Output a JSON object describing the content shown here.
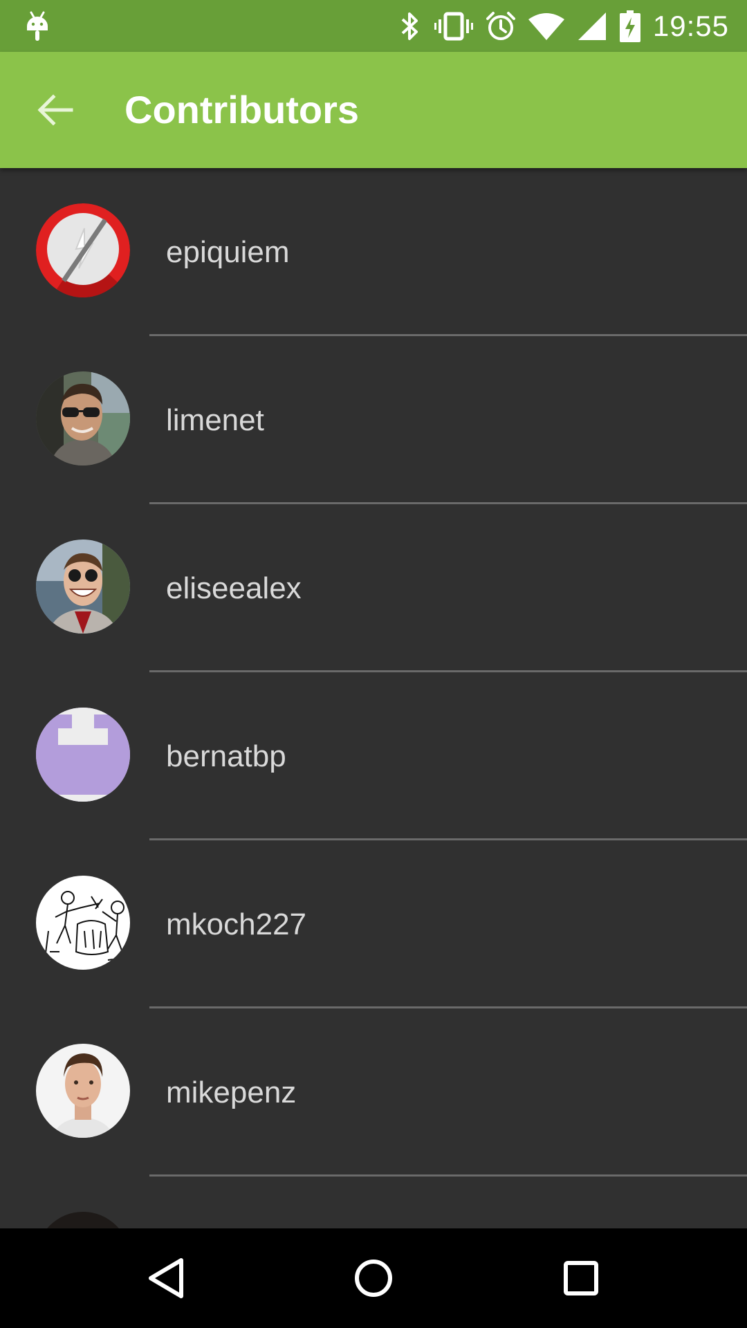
{
  "status_bar": {
    "time": "19:55",
    "icons": [
      "android-icon",
      "bluetooth-icon",
      "vibrate-icon",
      "alarm-icon",
      "wifi-icon",
      "cell-signal-icon",
      "battery-charging-icon"
    ]
  },
  "app_bar": {
    "title": "Contributors",
    "back_icon": "arrow-back-icon"
  },
  "colors": {
    "status_bar": "#689f38",
    "app_bar": "#8bc34a",
    "background": "#303030",
    "text": "#d9d9d9",
    "divider": "#6a6a6a",
    "nav_bar": "#000000"
  },
  "contributors": [
    {
      "name": "epiquiem",
      "avatar": "no-lightning-logo-avatar"
    },
    {
      "name": "limenet",
      "avatar": "photo-avatar-sunglasses"
    },
    {
      "name": "eliseealex",
      "avatar": "photo-avatar-smiling"
    },
    {
      "name": "bernatbp",
      "avatar": "purple-identicon-avatar"
    },
    {
      "name": "mkoch227",
      "avatar": "sketch-drawing-avatar"
    },
    {
      "name": "mikepenz",
      "avatar": "photo-avatar-portrait"
    },
    {
      "name": "",
      "avatar": "dark-photo-avatar"
    }
  ],
  "nav_bar": {
    "buttons": [
      "back-triangle-icon",
      "home-circle-icon",
      "recents-square-icon"
    ]
  }
}
